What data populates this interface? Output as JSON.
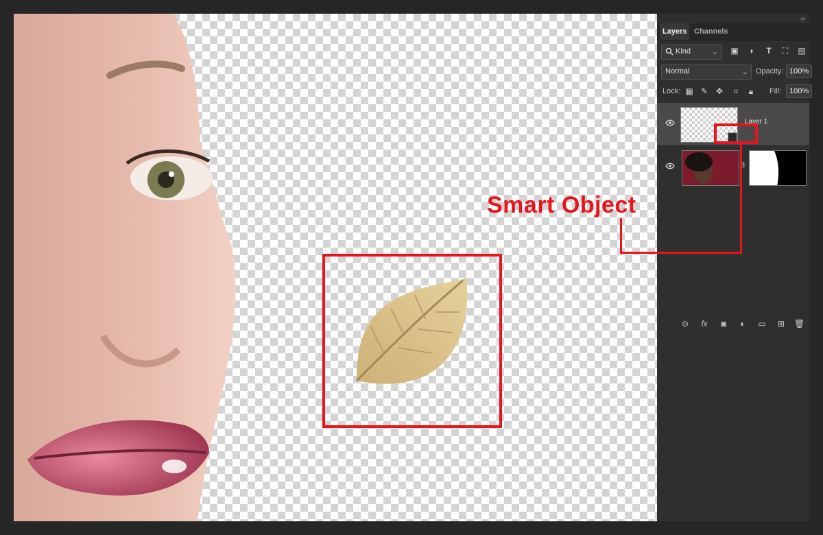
{
  "panel": {
    "collapse_glyph": "‹‹",
    "tabs": [
      "Layers",
      "Channels"
    ],
    "filter": {
      "kind_label": "Kind",
      "icons": [
        "image-filter-icon",
        "adjustment-filter-icon",
        "type-filter-icon",
        "shape-filter-icon",
        "smart-object-filter-icon"
      ]
    },
    "blend_mode": "Normal",
    "opacity_label": "Opacity:",
    "opacity_value": "100%",
    "lock_label": "Lock:",
    "fill_label": "Fill:",
    "fill_value": "100%",
    "layers": [
      {
        "name": "Layer 1",
        "type": "smart-object",
        "visible": true,
        "selected": true
      },
      {
        "name": "",
        "type": "masked-photo",
        "visible": true,
        "selected": false
      }
    ],
    "footer_icons": [
      "link-icon",
      "fx-icon",
      "mask-icon",
      "adjustment-icon",
      "folder-icon",
      "new-layer-icon",
      "trash-icon"
    ]
  },
  "annotation": {
    "label": "Smart Object",
    "color": "#e8141c"
  },
  "colors": {
    "app_bg": "#262626",
    "panel_bg": "#2f2f2f",
    "selected_layer": "#4a4a4a",
    "annotation_red": "#e8141c"
  }
}
